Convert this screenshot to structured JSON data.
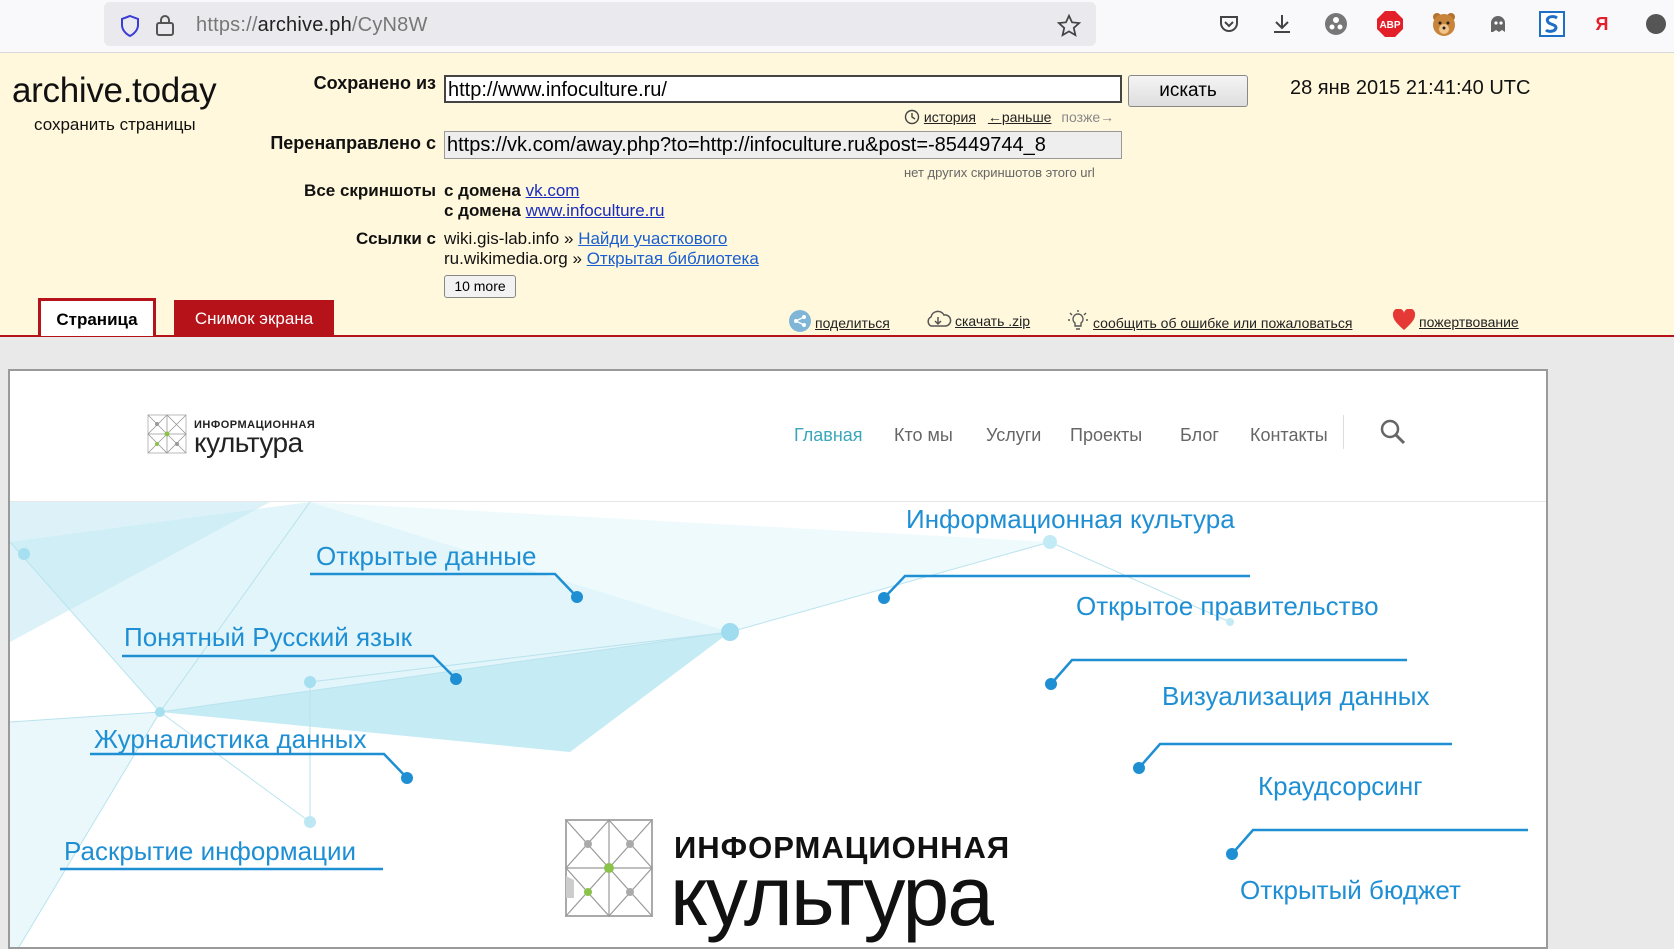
{
  "browser": {
    "url_scheme": "https://",
    "url_host": "archive.ph",
    "url_path": "/CyN8W",
    "extensions": [
      "shield-icon",
      "lock-icon",
      "star-icon",
      "pocket-icon",
      "download-icon",
      "puzzle-icon",
      "abp-icon",
      "bear-icon",
      "ghost-icon",
      "s-icon",
      "yandex-icon"
    ],
    "abp_label": "ABP",
    "yandex_label": "Я"
  },
  "archive": {
    "brand": "archive.today",
    "brand_sub": "сохранить страницы",
    "saved_from_label": "Сохранено из",
    "saved_from_value": "http://www.infoculture.ru/",
    "search_button": "искать",
    "datetime": "28 янв 2015 21:41:40 UTC",
    "history_link": "история",
    "earlier_link": "←раньше",
    "later_text": "позже→",
    "redirected_label": "Перенаправлено с",
    "redirected_value": "https://vk.com/away.php?to=http://infoculture.ru&post=-85449744_8",
    "no_other_text": "нет других скриншотов этого url",
    "all_screens_label": "Все скриншоты",
    "from_domain_1_prefix": "с домена",
    "from_domain_1": "vk.com",
    "from_domain_2_prefix": "с домена",
    "from_domain_2": "www.infoculture.ru",
    "links_label": "Ссылки с",
    "link_1_site": "wiki.gis-lab.info »",
    "link_1_title": "Найди участкового",
    "link_2_site": "ru.wikimedia.org »",
    "link_2_title": "Открытая библиотека",
    "more_button": "10 more",
    "tab_page": "Страница",
    "tab_screenshot": "Снимок экрана",
    "share": "поделиться",
    "download": "скачать .zip",
    "report": "сообщить об ошибке или пожаловаться",
    "donate": "пожертвование"
  },
  "site": {
    "logo_top": "ИНФОРМАЦИОННАЯ",
    "logo_bottom": "культура",
    "nav": [
      "Главная",
      "Кто мы",
      "Услуги",
      "Проекты",
      "Блог",
      "Контакты"
    ],
    "topics": {
      "open_data": "Открытые данные",
      "plain_russian": "Понятный Русский язык",
      "data_journalism": "Журналистика данных",
      "disclosure": "Раскрытие информации",
      "info_culture": "Информационная культура",
      "open_gov": "Открытое правительство",
      "data_viz": "Визуализация данных",
      "crowdsourcing": "Краудсорсинг",
      "open_budget": "Открытый бюджет"
    },
    "colors": {
      "accent": "#1f8fd4",
      "nav_active": "#3aa7b9",
      "archive_red": "#b6121a",
      "archive_bg": "#fff8dc"
    }
  }
}
